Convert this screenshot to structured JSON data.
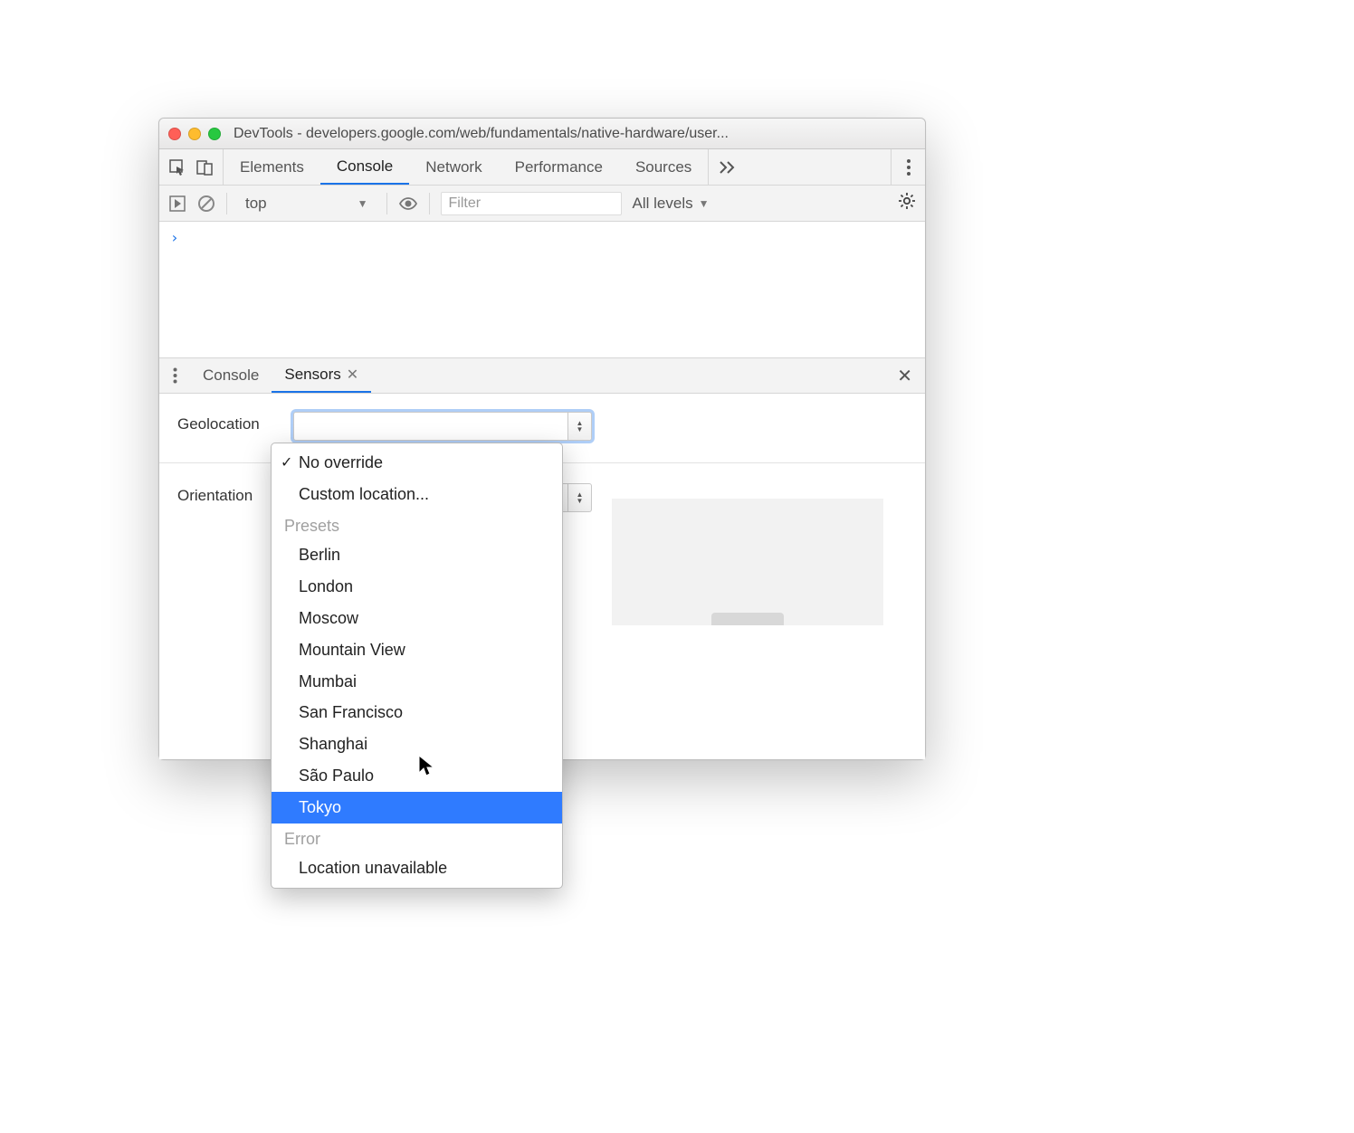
{
  "window": {
    "title": "DevTools - developers.google.com/web/fundamentals/native-hardware/user..."
  },
  "tabs": {
    "items": [
      "Elements",
      "Console",
      "Network",
      "Performance",
      "Sources"
    ],
    "active_index": 1
  },
  "console_toolbar": {
    "context": "top",
    "filter_placeholder": "Filter",
    "levels_label": "All levels"
  },
  "console_body": {
    "prompt": "›"
  },
  "drawer": {
    "tabs": [
      "Console",
      "Sensors"
    ],
    "active_index": 1
  },
  "sensors": {
    "geolocation_label": "Geolocation",
    "orientation_label": "Orientation"
  },
  "geo_dropdown": {
    "checked": "No override",
    "custom": "Custom location...",
    "group_presets_label": "Presets",
    "presets": [
      "Berlin",
      "London",
      "Moscow",
      "Mountain View",
      "Mumbai",
      "San Francisco",
      "Shanghai",
      "São Paulo",
      "Tokyo"
    ],
    "highlight": "Tokyo",
    "group_error_label": "Error",
    "errors": [
      "Location unavailable"
    ]
  }
}
